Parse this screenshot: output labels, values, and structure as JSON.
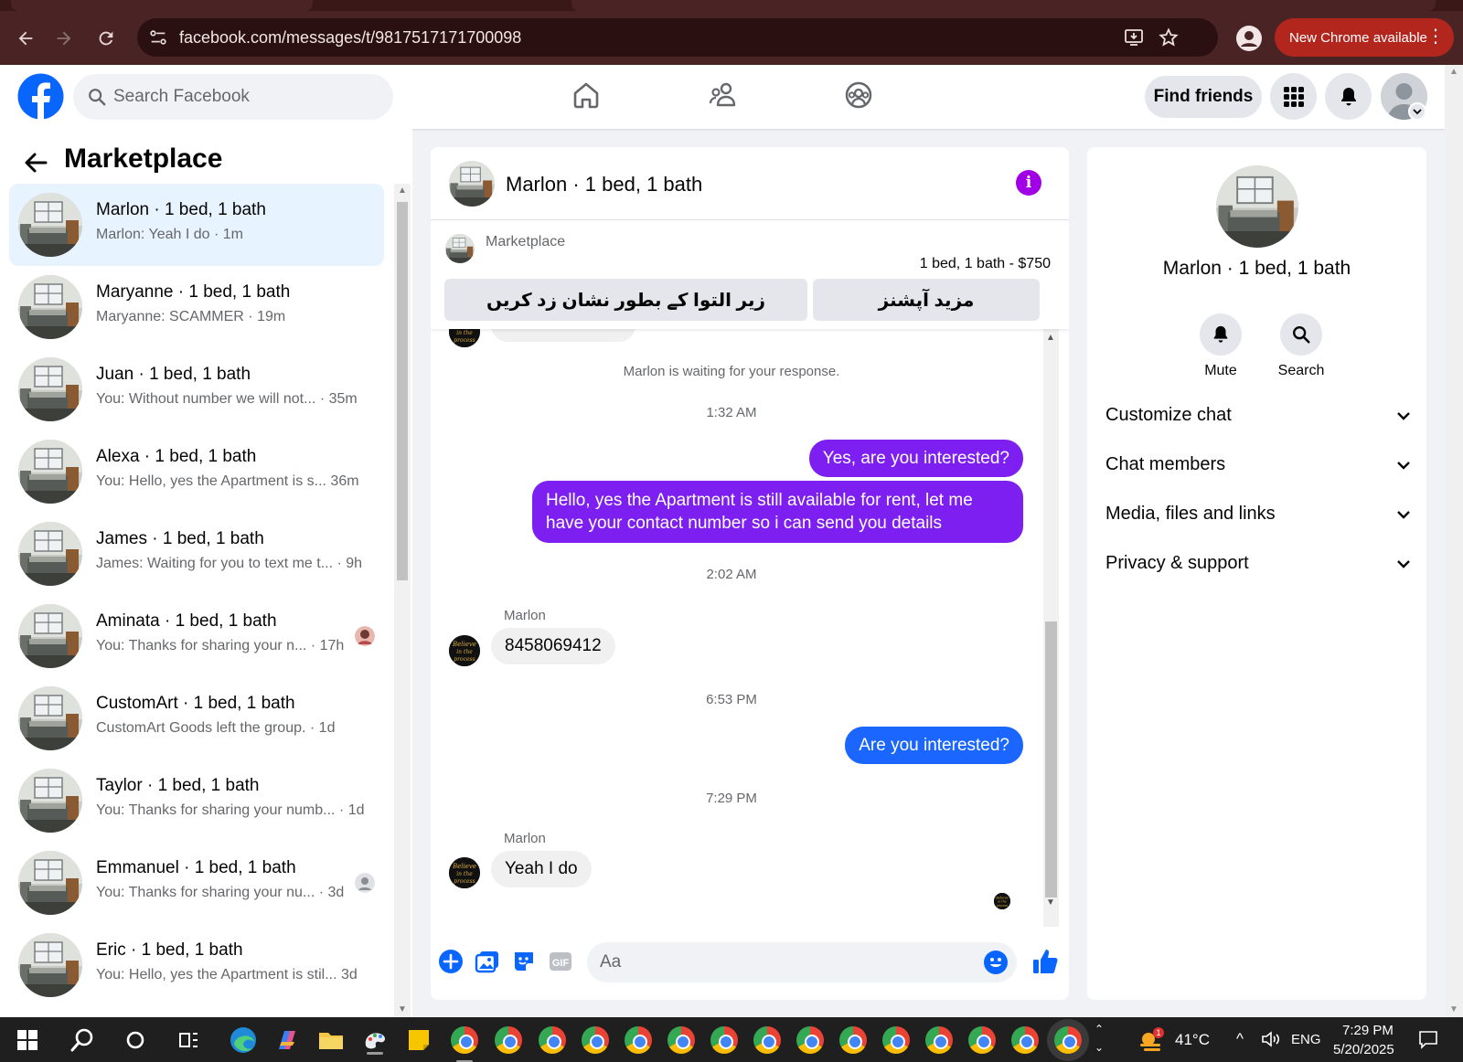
{
  "browser": {
    "url": "facebook.com/messages/t/9817517171700098",
    "update_label": "New Chrome available"
  },
  "header": {
    "search_placeholder": "Search Facebook",
    "find_friends": "Find friends"
  },
  "sidebar": {
    "title": "Marketplace",
    "conversations": [
      {
        "name": "Marlon · 1 bed, 1 bath",
        "preview": "Marlon: Yeah I do · 1m",
        "active": true
      },
      {
        "name": "Maryanne · 1 bed, 1 bath",
        "preview": "Maryanne: SCAMMER · 19m"
      },
      {
        "name": "Juan · 1 bed, 1 bath",
        "preview": "You: Without number we will not... · 35m"
      },
      {
        "name": "Alexa · 1 bed, 1 bath",
        "preview": "You: Hello, yes the Apartment is s... 36m"
      },
      {
        "name": "James · 1 bed, 1 bath",
        "preview": "James: Waiting for you to text me t... · 9h"
      },
      {
        "name": "Aminata · 1 bed, 1 bath",
        "preview": "You: Thanks for sharing your n... · 17h"
      },
      {
        "name": "CustomArt · 1 bed, 1 bath",
        "preview": "CustomArt Goods left the group. · 1d"
      },
      {
        "name": "Taylor · 1 bed, 1 bath",
        "preview": "You: Thanks for sharing your numb... · 1d"
      },
      {
        "name": "Emmanuel · 1 bed, 1 bath",
        "preview": "You: Thanks for sharing your nu... · 3d"
      },
      {
        "name": "Eric · 1 bed, 1 bath",
        "preview": "You: Hello, yes the Apartment is stil... 3d"
      }
    ]
  },
  "chat": {
    "title": "Marlon · 1 bed, 1 bath",
    "marketplace_label": "Marketplace",
    "listing": "1 bed, 1 bath - $750",
    "mark_pending_label": "زیر التوا کے بطور نشان زد کریں",
    "more_options_label": "مزید آپشنز",
    "waiting_notice": "Marlon is waiting for your response.",
    "time_1": "1:32 AM",
    "out_1": "Yes, are you interested?",
    "out_2": "Hello, yes the Apartment is still available for rent, let me have your contact number so i can send you details",
    "time_2": "2:02 AM",
    "sender_1": "Marlon",
    "in_1": "8458069412",
    "time_3": "6:53 PM",
    "out_3": "Are you interested?",
    "time_4": "7:29 PM",
    "sender_2": "Marlon",
    "in_2": "Yeah I do",
    "composer_placeholder": "Aa"
  },
  "info": {
    "name": "Marlon · 1 bed, 1 bath",
    "mute_label": "Mute",
    "search_label": "Search",
    "sections": [
      "Customize chat",
      "Chat members",
      "Media, files and links",
      "Privacy & support"
    ]
  },
  "taskbar": {
    "weather_badge": "1",
    "temperature": "41°C",
    "language": "ENG",
    "time": "7:29 PM",
    "date": "5/20/2025"
  },
  "colors": {
    "facebook_blue": "#0866ff",
    "outgoing_purple": "#7d1ff0",
    "outgoing_blue": "#1a66ff",
    "info_purple": "#a100e6",
    "chrome_toolbar": "#4a2424",
    "update_red": "#b3261e"
  }
}
